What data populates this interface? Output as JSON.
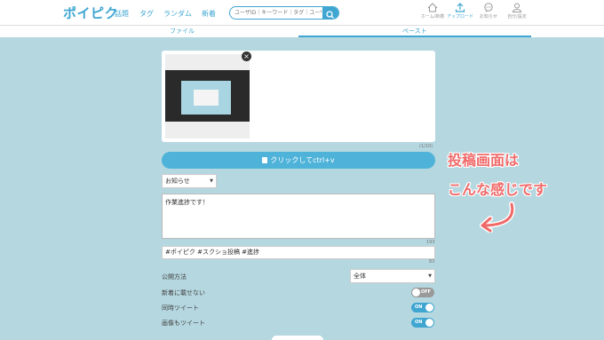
{
  "header": {
    "logo": "ポイピク",
    "nav": [
      "話題",
      "タグ",
      "ランダム",
      "新着"
    ],
    "search_placeholder": "ユーザID｜キーワード｜タグ｜ユーザ",
    "icons": [
      {
        "name": "home-icon",
        "label": "ホーム/新着"
      },
      {
        "name": "upload-icon",
        "label": "アップロード"
      },
      {
        "name": "notification-icon",
        "label": "お知らせ"
      },
      {
        "name": "user-icon",
        "label": "自分/設定"
      }
    ]
  },
  "tabs": [
    "ファイル",
    "ペースト"
  ],
  "form": {
    "image_counter": "(1/10)",
    "click_button": "クリックしてctrl+v",
    "category": "お知らせ",
    "description": "作業進捗です！",
    "description_counter": "193",
    "tags": "#ポイピク #スクショ投稿 #進捗",
    "tags_counter": "83",
    "visibility_label": "公開方法",
    "visibility_value": "全体",
    "options": [
      {
        "label": "新着に載せない",
        "state": "OFF"
      },
      {
        "label": "同時ツイート",
        "state": "ON"
      },
      {
        "label": "画像もツイート",
        "state": "ON"
      }
    ]
  },
  "annotation": {
    "line1": "投稿画面は",
    "line2": "こんな感じです"
  },
  "colors": {
    "accent": "#3ea6d1",
    "background": "#b5d7e0",
    "annotation": "#f06a6a"
  }
}
